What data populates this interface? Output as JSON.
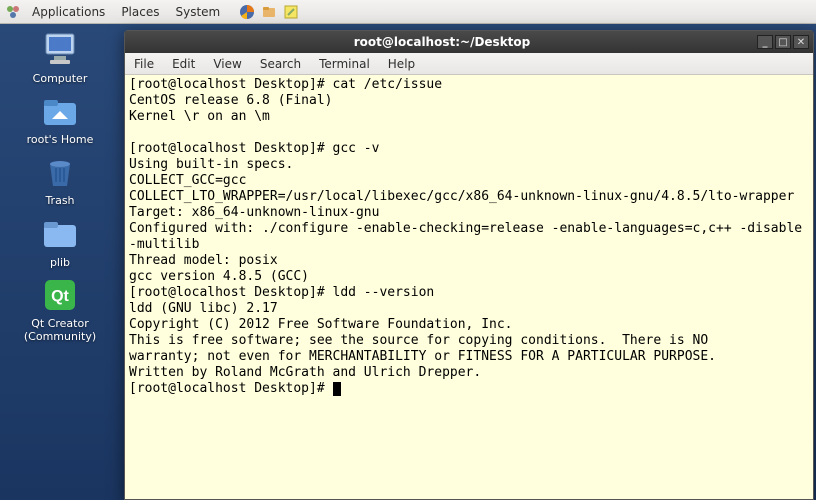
{
  "panel": {
    "menus": [
      "Applications",
      "Places",
      "System"
    ]
  },
  "desktop_icons": [
    {
      "label": "Computer",
      "kind": "computer"
    },
    {
      "label": "root's Home",
      "kind": "home"
    },
    {
      "label": "Trash",
      "kind": "trash"
    },
    {
      "label": "plib",
      "kind": "folder"
    },
    {
      "label": "Qt Creator\n(Community)",
      "kind": "qt"
    }
  ],
  "window": {
    "title": "root@localhost:~/Desktop",
    "menus": [
      "File",
      "Edit",
      "View",
      "Search",
      "Terminal",
      "Help"
    ],
    "buttons": {
      "min": "_",
      "max": "□",
      "close": "✕"
    }
  },
  "terminal": {
    "lines": [
      "[root@localhost Desktop]# cat /etc/issue",
      "CentOS release 6.8 (Final)",
      "Kernel \\r on an \\m",
      "",
      "[root@localhost Desktop]# gcc -v",
      "Using built-in specs.",
      "COLLECT_GCC=gcc",
      "COLLECT_LTO_WRAPPER=/usr/local/libexec/gcc/x86_64-unknown-linux-gnu/4.8.5/lto-wrapper",
      "Target: x86_64-unknown-linux-gnu",
      "Configured with: ./configure -enable-checking=release -enable-languages=c,c++ -disable-multilib",
      "Thread model: posix",
      "gcc version 4.8.5 (GCC)",
      "[root@localhost Desktop]# ldd --version",
      "ldd (GNU libc) 2.17",
      "Copyright (C) 2012 Free Software Foundation, Inc.",
      "This is free software; see the source for copying conditions.  There is NO",
      "warranty; not even for MERCHANTABILITY or FITNESS FOR A PARTICULAR PURPOSE.",
      "Written by Roland McGrath and Ulrich Drepper.",
      "[root@localhost Desktop]# "
    ]
  }
}
